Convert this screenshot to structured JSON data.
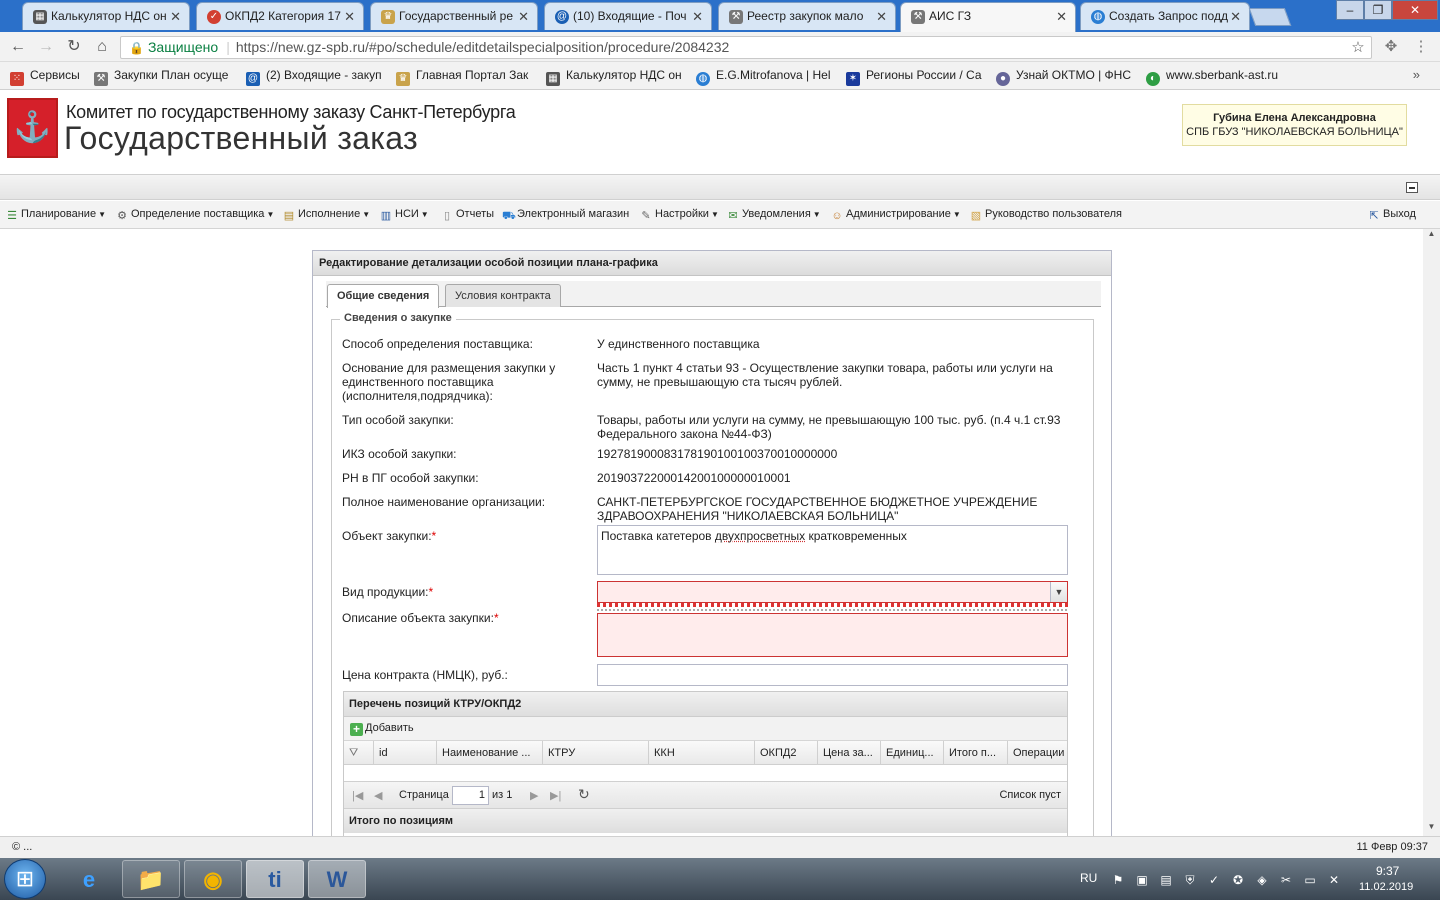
{
  "browser": {
    "tabs": [
      {
        "title": "Калькулятор НДС он",
        "icon_color": "#555555",
        "icon": "grid"
      },
      {
        "title": "ОКПД2 Категория 17",
        "icon_color": "#d23f31",
        "icon": "check"
      },
      {
        "title": "Государственный ре",
        "icon_color": "#c9a34b",
        "icon": "crown"
      },
      {
        "title": "(10) Входящие - Поч",
        "icon_color": "#1a5fb4",
        "icon": "at"
      },
      {
        "title": "Реестр закупок мало",
        "icon_color": "#777777",
        "icon": "tools"
      },
      {
        "title": "АИС ГЗ",
        "icon_color": "#777777",
        "icon": "tools"
      },
      {
        "title": "Создать Запрос подд",
        "icon_color": "#2a7ed3",
        "icon": "globe"
      }
    ],
    "address": {
      "secure_label": "Защищено",
      "url": "https://new.gz-spb.ru/#po/schedule/editdetailspecialposition/procedure/2084232"
    },
    "bookmarks": [
      {
        "label": "Сервисы",
        "icon_color": "#d23f31"
      },
      {
        "label": "Закупки План осуще",
        "icon_color": "#777777"
      },
      {
        "label": "(2) Входящие - закуп",
        "icon_color": "#1a5fb4"
      },
      {
        "label": "Главная Портал Зак",
        "icon_color": "#c9a34b"
      },
      {
        "label": "Калькулятор НДС он",
        "icon_color": "#555555"
      },
      {
        "label": "E.G.Mitrofanova | Hel",
        "icon_color": "#2a7ed3"
      },
      {
        "label": "Регионы России / Са",
        "icon_color": "#1a3a9c"
      },
      {
        "label": "Узнай ОКТМО | ФНС",
        "icon_color": "#666699"
      },
      {
        "label": "www.sberbank-ast.ru",
        "icon_color": "#2e9e44"
      }
    ],
    "bookmarks_more": "»"
  },
  "header": {
    "committee": "Комитет по государственному заказу Санкт-Петербурга",
    "title": "Государственный заказ",
    "user_name": "Губина Елена Александровна",
    "user_org": "СПБ ГБУЗ \"НИКОЛАЕВСКАЯ БОЛЬНИЦА\""
  },
  "menu": [
    {
      "label": "Планирование",
      "dropdown": true,
      "icon_color": "#3a8a3a"
    },
    {
      "label": "Определение поставщика",
      "dropdown": true,
      "icon_color": "#666666"
    },
    {
      "label": "Исполнение",
      "dropdown": true,
      "icon_color": "#b08a2a"
    },
    {
      "label": "НСИ",
      "dropdown": true,
      "icon_color": "#2a5aa0"
    },
    {
      "label": "Отчеты",
      "dropdown": false,
      "icon_color": "#888888"
    },
    {
      "label": "Электронный магазин",
      "dropdown": false,
      "icon_color": "#2a7ed3"
    },
    {
      "label": "Настройки",
      "dropdown": true,
      "icon_color": "#666666"
    },
    {
      "label": "Уведомления",
      "dropdown": true,
      "icon_color": "#3a8a3a"
    },
    {
      "label": "Администрирование",
      "dropdown": true,
      "icon_color": "#c27a2a"
    },
    {
      "label": "Руководство пользователя",
      "dropdown": false,
      "icon_color": "#d0a040"
    }
  ],
  "exit_label": "Выход",
  "panel": {
    "title": "Редактирование детализации особой позиции плана-графика",
    "tabs": [
      "Общие сведения",
      "Условия контракта"
    ],
    "section_legend": "Сведения о закупке",
    "fields": [
      {
        "label": "Способ определения поставщика:",
        "value": "У единственного поставщика"
      },
      {
        "label": "Основание для размещения закупки у единственного поставщика (исполнителя,подрядчика):",
        "value": "Часть 1 пункт 4 статьи 93 - Осуществление закупки товара, работы или услуги на сумму, не превышающую ста тысяч рублей."
      },
      {
        "label": "Тип особой закупки:",
        "value": "Товары, работы или услуги на сумму, не превышающую 100 тыс. руб. (п.4 ч.1 ст.93 Федерального закона №44-ФЗ)"
      },
      {
        "label": "ИКЗ особой закупки:",
        "value": "192781900083178190100100370010000000"
      },
      {
        "label": "РН в ПГ особой закупки:",
        "value": "20190372200014200100000010001"
      },
      {
        "label": "Полное наименование организации:",
        "value": "САНКТ-ПЕТЕРБУРГСКОЕ ГОСУДАРСТВЕННОЕ БЮДЖЕТНОЕ УЧРЕЖДЕНИЕ ЗДРАВООХРАНЕНИЯ \"НИКОЛАЕВСКАЯ БОЛЬНИЦА\""
      }
    ],
    "object_label": "Объект закупки:",
    "object_value_pre": "Поставка катетеров ",
    "object_value_mark": "двухпросветных",
    "object_value_post": " кратковременных",
    "product_type_label": "Вид продукции:",
    "product_type_value": "",
    "description_label": "Описание объекта закупки:",
    "price_label": "Цена контракта (НМЦК), руб.:",
    "price_value": "",
    "required_mark": "*",
    "grid": {
      "title": "Перечень позиций КТРУ/ОКПД2",
      "add_label": "Добавить",
      "columns": [
        "id",
        "Наименование ...",
        "КТРУ",
        "ККН",
        "ОКПД2",
        "Цена за...",
        "Единиц...",
        "Итого п...",
        "Операции"
      ],
      "pager_page_label": "Страница",
      "pager_page_value": "1",
      "pager_of": "из 1",
      "pager_empty": "Список пуст",
      "totals_title": "Итого по позициям"
    }
  },
  "status": {
    "left": "© ...",
    "right": "11 Февр 09:37"
  },
  "taskbar": {
    "lang": "RU",
    "time": "9:37",
    "date": "11.02.2019",
    "apps": [
      "e",
      "📁",
      "◉",
      "ti",
      "W"
    ]
  }
}
